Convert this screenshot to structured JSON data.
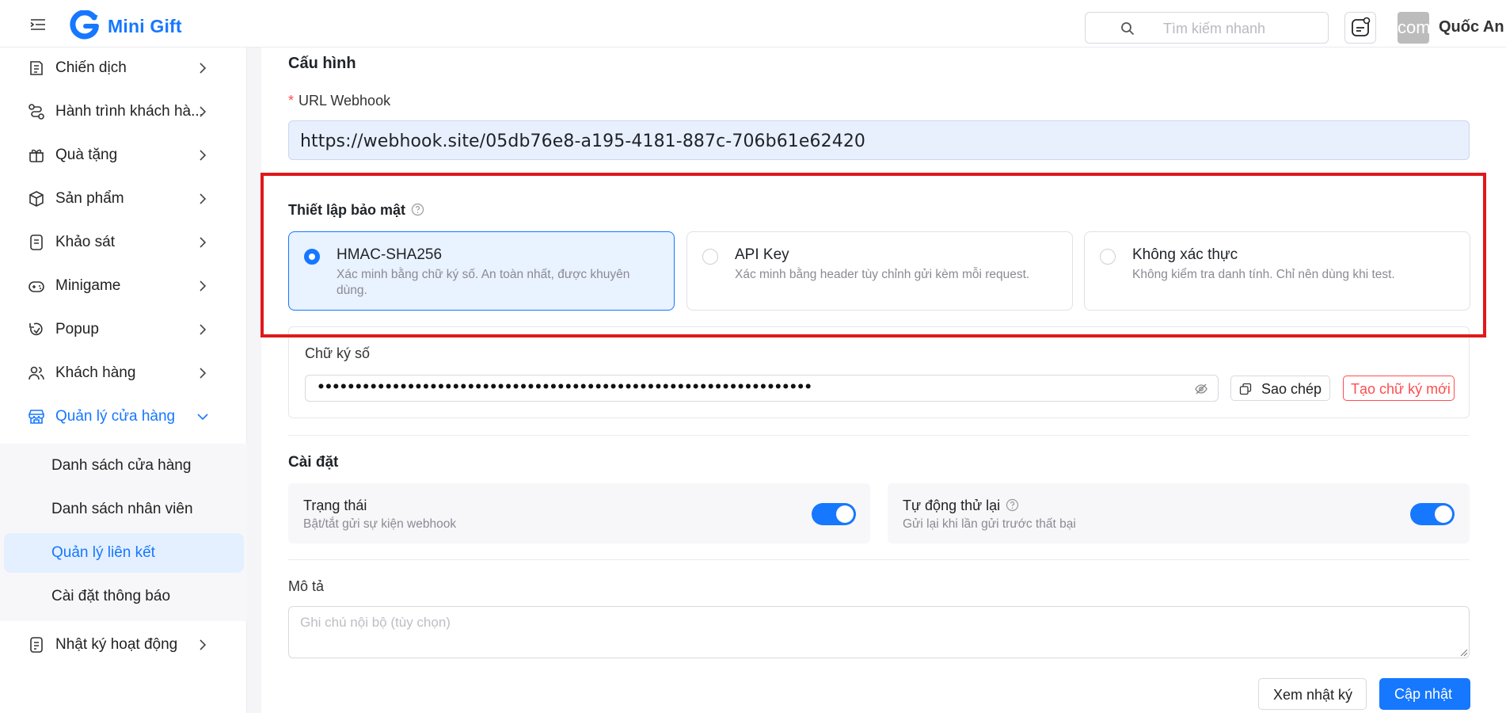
{
  "header": {
    "brand": "Mini Gift",
    "search_placeholder": "Tìm kiếm nhanh",
    "avatar_text": "com",
    "username": "Quốc An"
  },
  "sidebar": {
    "items": [
      {
        "label": "Chiến dịch",
        "icon": "campaign-icon"
      },
      {
        "label": "Hành trình khách hà...",
        "icon": "journey-icon"
      },
      {
        "label": "Quà tặng",
        "icon": "gift-icon"
      },
      {
        "label": "Sản phẩm",
        "icon": "product-box-icon"
      },
      {
        "label": "Khảo sát",
        "icon": "survey-icon"
      },
      {
        "label": "Minigame",
        "icon": "gamepad-icon"
      },
      {
        "label": "Popup",
        "icon": "popup-icon"
      },
      {
        "label": "Khách hàng",
        "icon": "customers-icon"
      },
      {
        "label": "Quản lý cửa hàng",
        "icon": "store-icon",
        "expanded": true
      },
      {
        "label": "Nhật ký hoạt động",
        "icon": "activity-log-icon"
      }
    ],
    "subitems": [
      {
        "label": "Danh sách cửa hàng"
      },
      {
        "label": "Danh sách nhân viên"
      },
      {
        "label": "Quản lý liên kết",
        "active": true
      },
      {
        "label": "Cài đặt thông báo"
      }
    ]
  },
  "config": {
    "title": "Cấu hình",
    "url_label": "URL Webhook",
    "url_value": "https://webhook.site/05db76e8-a195-4181-887c-706b61e62420"
  },
  "security": {
    "title": "Thiết lập bảo mật",
    "options": [
      {
        "title": "HMAC-SHA256",
        "desc": "Xác minh bằng chữ ký số. An toàn nhất, được khuyên dùng.",
        "selected": true
      },
      {
        "title": "API Key",
        "desc": "Xác minh bằng header tùy chỉnh gửi kèm mỗi request.",
        "selected": false
      },
      {
        "title": "Không xác thực",
        "desc": "Không kiểm tra danh tính. Chỉ nên dùng khi test.",
        "selected": false
      }
    ],
    "signature_label": "Chữ ký số",
    "signature_value": "••••••••••••••••••••••••••••••••••••••••••••••••••••••••••••••••••",
    "copy_label": "Sao chép",
    "regenerate_label": "Tạo chữ ký mới"
  },
  "settings": {
    "title": "Cài đặt",
    "status": {
      "title": "Trạng thái",
      "desc": "Bật/tắt gửi sự kiện webhook",
      "enabled": true
    },
    "auto_retry": {
      "title": "Tự động thử lại",
      "desc": "Gửi lại khi lần gửi trước thất bại",
      "enabled": true
    }
  },
  "description": {
    "label": "Mô tả",
    "placeholder": "Ghi chú nội bộ (tùy chọn)"
  },
  "actions": {
    "view_log": "Xem nhật ký",
    "update": "Cập nhật"
  },
  "colors": {
    "accent": "#1677ff",
    "danger": "#ff4d4f",
    "highlight": "#e0181b"
  }
}
